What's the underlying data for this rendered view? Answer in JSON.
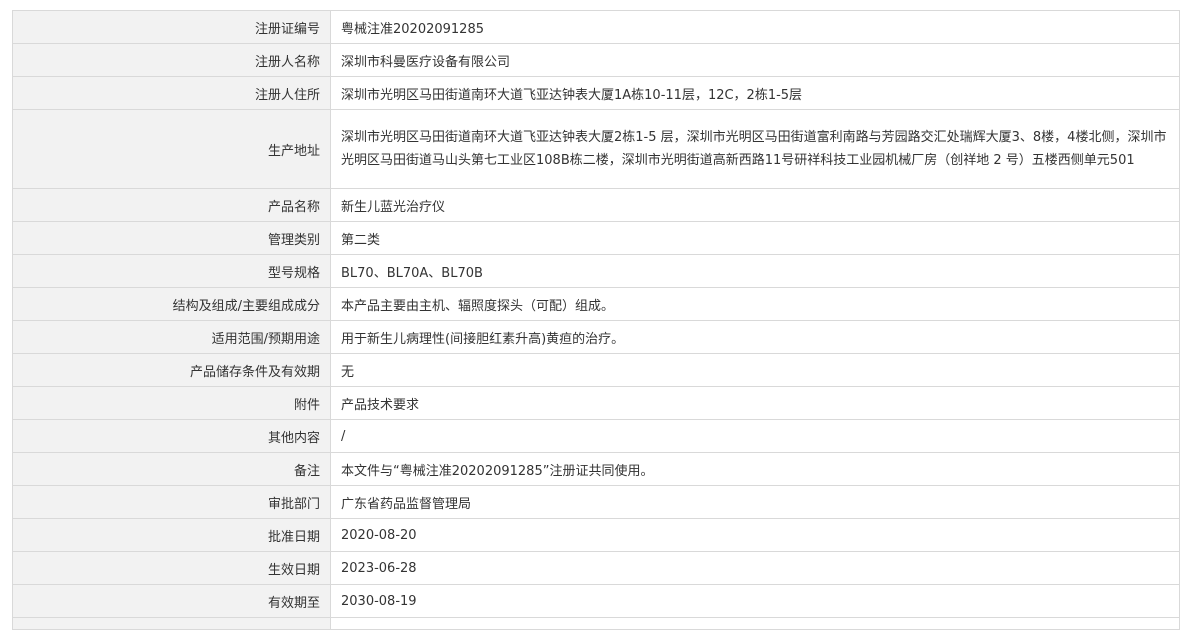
{
  "rows": [
    {
      "label": "注册证编号",
      "value": "粤械注准20202091285"
    },
    {
      "label": "注册人名称",
      "value": "深圳市科曼医疗设备有限公司"
    },
    {
      "label": "注册人住所",
      "value": "深圳市光明区马田街道南环大道飞亚达钟表大厦1A栋10-11层，12C，2栋1-5层"
    },
    {
      "label": "生产地址",
      "value": "深圳市光明区马田街道南环大道飞亚达钟表大厦2栋1-5 层，深圳市光明区马田街道富利南路与芳园路交汇处瑞辉大厦3、8楼，4楼北侧，深圳市光明区马田街道马山头第七工业区108B栋二楼，深圳市光明街道高新西路11号研祥科技工业园机械厂房（创祥地 2 号）五楼西侧单元501"
    },
    {
      "label": "产品名称",
      "value": "新生儿蓝光治疗仪"
    },
    {
      "label": "管理类别",
      "value": "第二类"
    },
    {
      "label": "型号规格",
      "value": "BL70、BL70A、BL70B"
    },
    {
      "label": "结构及组成/主要组成成分",
      "value": "本产品主要由主机、辐照度探头（可配）组成。"
    },
    {
      "label": "适用范围/预期用途",
      "value": "用于新生儿病理性(间接胆红素升高)黄疸的治疗。"
    },
    {
      "label": "产品储存条件及有效期",
      "value": "无"
    },
    {
      "label": "附件",
      "value": "产品技术要求"
    },
    {
      "label": "其他内容",
      "value": "/"
    },
    {
      "label": "备注",
      "value": "本文件与“粤械注准20202091285”注册证共同使用。"
    },
    {
      "label": "审批部门",
      "value": "广东省药品监督管理局"
    },
    {
      "label": "批准日期",
      "value": "2020-08-20"
    },
    {
      "label": "生效日期",
      "value": "2023-06-28"
    },
    {
      "label": "有效期至",
      "value": "2030-08-19"
    }
  ]
}
